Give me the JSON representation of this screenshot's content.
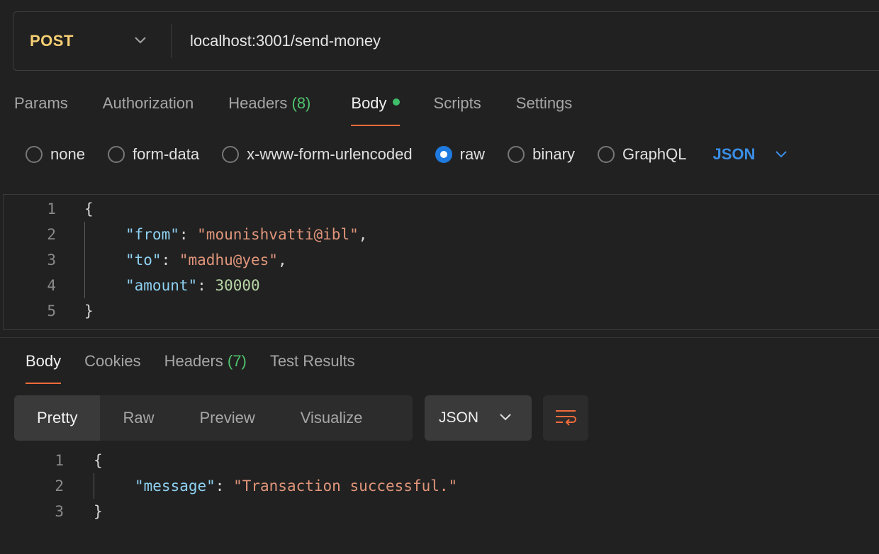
{
  "request": {
    "method": "POST",
    "url": "localhost:3001/send-money"
  },
  "request_tabs": [
    {
      "label": "Params"
    },
    {
      "label": "Authorization"
    },
    {
      "label": "Headers",
      "count": "(8)"
    },
    {
      "label": "Body",
      "active": true
    },
    {
      "label": "Scripts"
    },
    {
      "label": "Settings"
    }
  ],
  "body_types": [
    "none",
    "form-data",
    "x-www-form-urlencoded",
    "raw",
    "binary",
    "GraphQL"
  ],
  "body_language": "JSON",
  "request_body": {
    "line_numbers": [
      "1",
      "2",
      "3",
      "4",
      "5"
    ],
    "open_brace": "{",
    "close_brace": "}",
    "from_key": "\"from\"",
    "from_value": "\"mounishvatti@ibl\"",
    "to_key": "\"to\"",
    "to_value": "\"madhu@yes\"",
    "amount_key": "\"amount\"",
    "amount_value": "30000"
  },
  "response_tabs": [
    {
      "label": "Body",
      "active": true
    },
    {
      "label": "Cookies"
    },
    {
      "label": "Headers",
      "count": "(7)"
    },
    {
      "label": "Test Results"
    }
  ],
  "view_modes": [
    "Pretty",
    "Raw",
    "Preview",
    "Visualize"
  ],
  "response_format": "JSON",
  "response_body": {
    "line_numbers": [
      "1",
      "2",
      "3"
    ],
    "open_brace": "{",
    "close_brace": "}",
    "message_key": "\"message\"",
    "message_value": "\"Transaction successful.\""
  },
  "colors": {
    "method": "#f6cf73",
    "accent_underline": "#f26b3a",
    "count": "#4fc46d",
    "radio_selected": "#1f7ae0",
    "language": "#3a8ee6",
    "json_key": "#8ed1f2",
    "json_string": "#e0957a",
    "json_number": "#b7d7a6"
  }
}
